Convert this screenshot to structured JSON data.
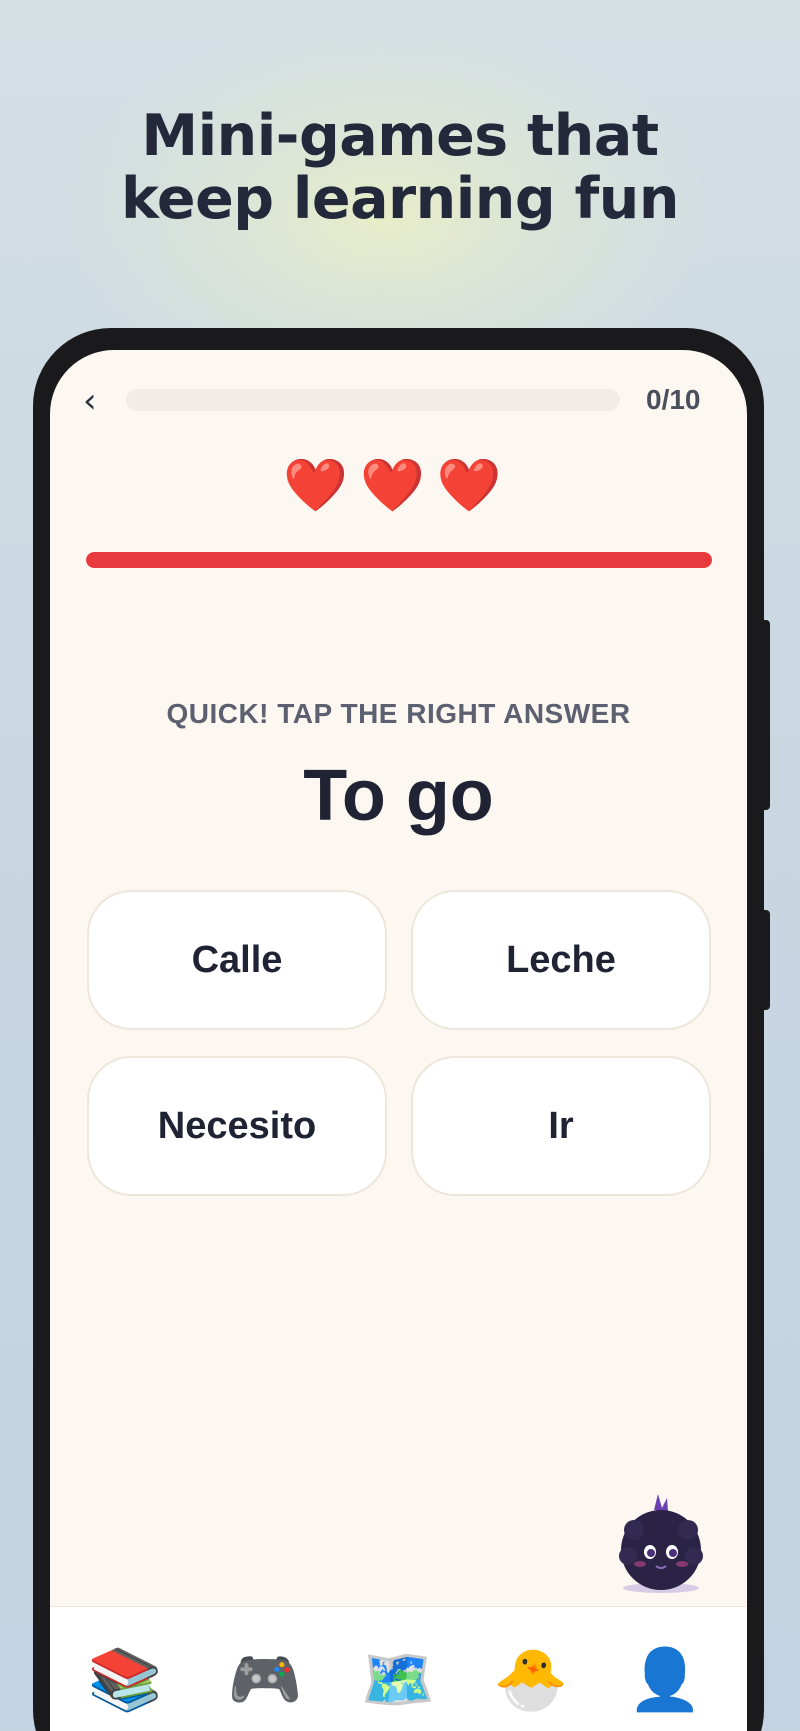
{
  "headline": {
    "line1": "Mini-games that",
    "line2": "keep learning fun"
  },
  "game": {
    "back_icon": "chevron-left-icon",
    "progress_text": "0/10",
    "progress_fraction": 0.0,
    "hearts": "❤️❤️❤️",
    "lives": 3,
    "timer_fraction": 1.0,
    "prompt": "QUICK! TAP THE RIGHT ANSWER",
    "word": "To go",
    "options": [
      "Calle",
      "Leche",
      "Necesito",
      "Ir"
    ]
  },
  "tabbar": {
    "tabs": [
      {
        "icon": "books-icon",
        "glyph": "📚"
      },
      {
        "icon": "gamepad-icon",
        "glyph": "🎮"
      },
      {
        "icon": "map-icon",
        "glyph": "🗺️"
      },
      {
        "icon": "hatching-chick-icon",
        "glyph": "🐣"
      },
      {
        "icon": "profile-icon",
        "glyph": "👤"
      }
    ]
  },
  "colors": {
    "accent_red": "#e8393e",
    "text_dark": "#1f2333",
    "screen_bg": "#fcf8f1"
  }
}
